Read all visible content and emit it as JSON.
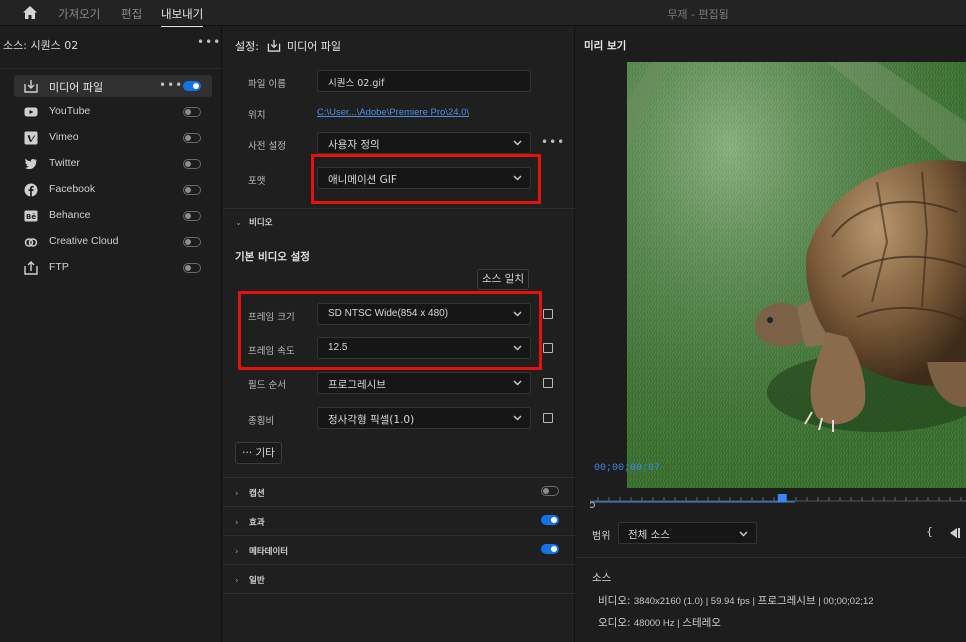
{
  "topbar": {
    "tabs": [
      "가져오기",
      "편집",
      "내보내기"
    ],
    "active_tab": "내보내기",
    "doc_title": "무제 - 편집됨"
  },
  "source_panel": {
    "label": "소스:  시퀀스 02",
    "more": "•••",
    "destinations": [
      {
        "label": "미디어 파일",
        "icon": "media-file-icon",
        "enabled": true,
        "selected": true
      },
      {
        "label": "YouTube",
        "icon": "youtube-icon",
        "enabled": false
      },
      {
        "label": "Vimeo",
        "icon": "vimeo-icon",
        "enabled": false
      },
      {
        "label": "Twitter",
        "icon": "twitter-icon",
        "enabled": false
      },
      {
        "label": "Facebook",
        "icon": "facebook-icon",
        "enabled": false
      },
      {
        "label": "Behance",
        "icon": "behance-icon",
        "enabled": false
      },
      {
        "label": "Creative Cloud",
        "icon": "creative-cloud-icon",
        "enabled": false
      },
      {
        "label": "FTP",
        "icon": "ftp-icon",
        "enabled": false
      }
    ]
  },
  "settings": {
    "title": "설정:",
    "title_target": "미디어 파일",
    "file_name_label": "파일 이름",
    "file_name_value": "시퀀스 02.gif",
    "location_label": "위치",
    "location_value": "C:\\User...\\Adobe\\Premiere Pro\\24.0\\",
    "preset_label": "사전 설정",
    "preset_value": "사용자 정의",
    "format_label": "포맷",
    "format_value": "애니메이션 GIF",
    "video_section": "비디오",
    "basic_video_title": "기본 비디오 설정",
    "match_source_button": "소스 일치",
    "frame_size_label": "프레임 크기",
    "frame_size_value": "SD NTSC Wide(854 x 480)",
    "frame_rate_label": "프레임 속도",
    "frame_rate_value": "12.5",
    "field_order_label": "필드 순서",
    "field_order_value": "프로그레시브",
    "aspect_label": "종횡비",
    "aspect_value": "정사각형 픽셀(1.0)",
    "more_button": "··· 기타",
    "sections": [
      {
        "label": "캡션",
        "enabled": false
      },
      {
        "label": "효과",
        "enabled": true
      },
      {
        "label": "메타데이터",
        "enabled": true
      },
      {
        "label": "일반",
        "enabled": null
      }
    ]
  },
  "preview": {
    "title": "미리 보기",
    "timecode": "00;00;00;07",
    "range_label": "범위",
    "range_value": "전체 소스",
    "source_head": "소스",
    "video_label": "비디오:",
    "video_value": "3840x2160 (1.0) | 59.94 fps | ",
    "video_value_ko": "프로그레시브",
    "video_value_tail": " | 00;00;02;12",
    "audio_label": "오디오:",
    "audio_value": "48000 Hz | ",
    "audio_value_ko": "스테레오",
    "playhead_progress": 0.51
  }
}
